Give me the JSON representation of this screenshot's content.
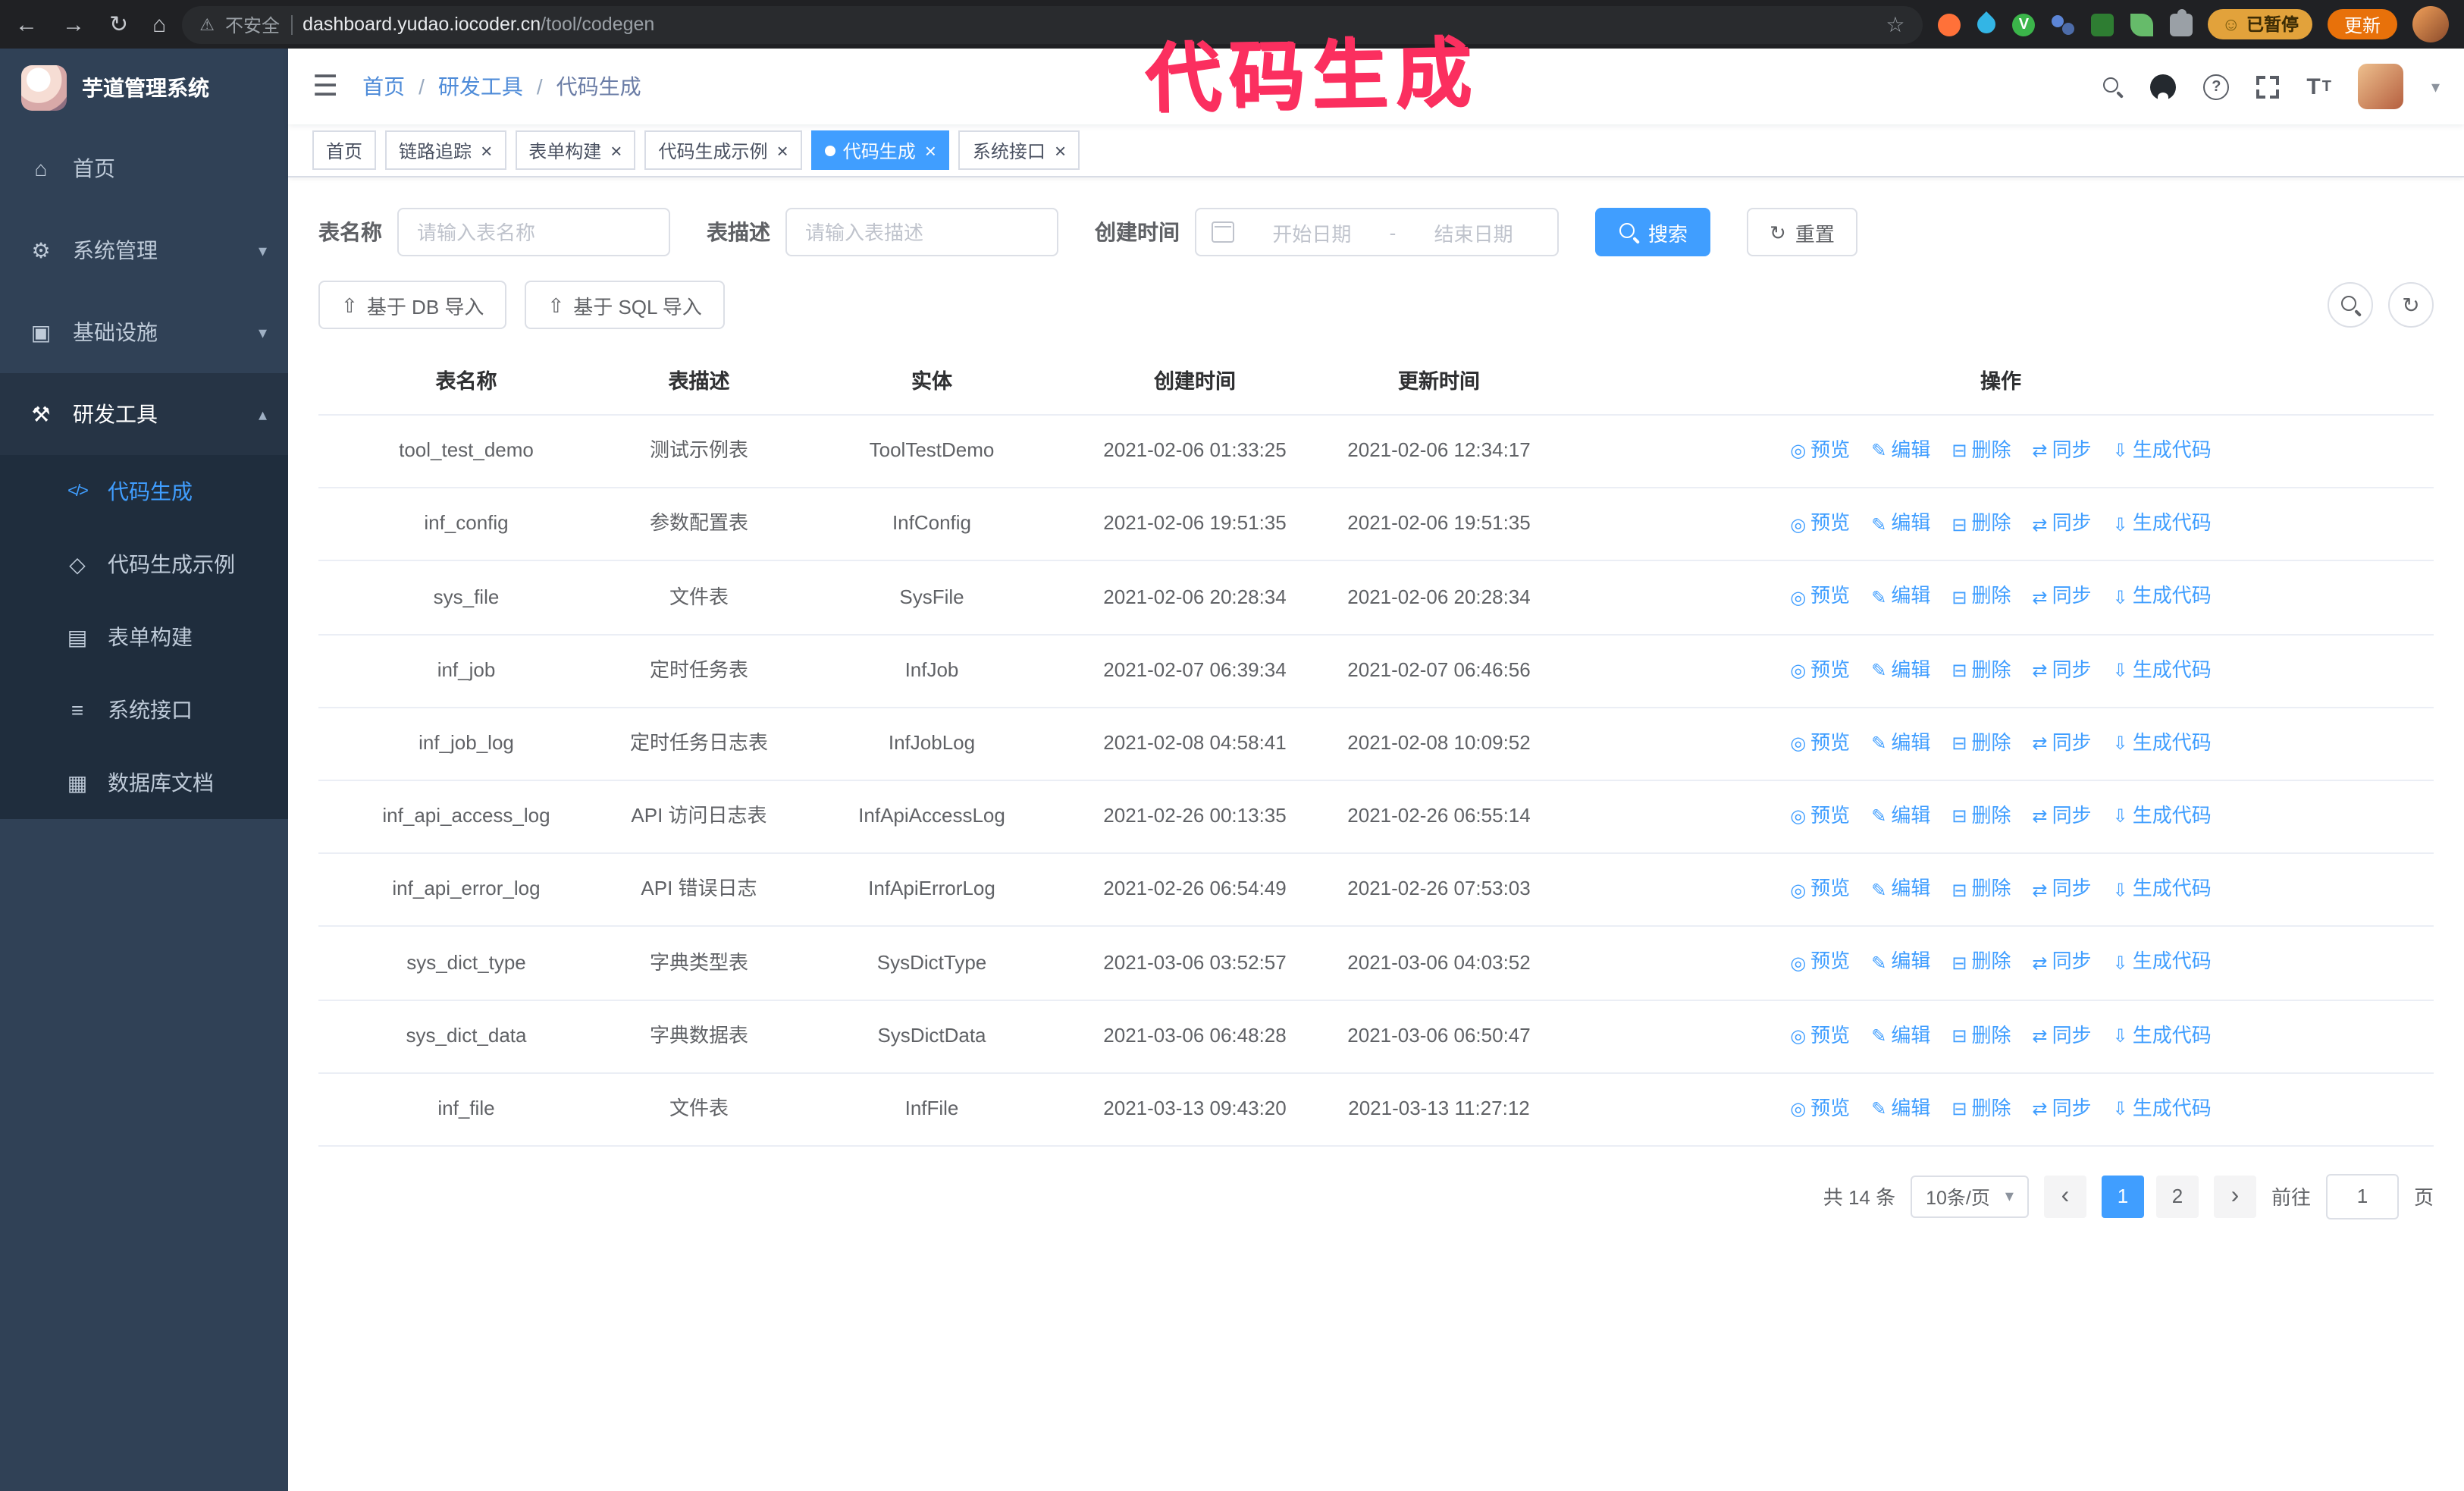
{
  "annotation": {
    "text": "代码生成"
  },
  "colors": {
    "primary": "#409eff",
    "sidebar_bg": "#304156",
    "submenu_bg": "#1f2d3d",
    "annotation": "#fb2f5f",
    "chrome_bg": "#202124",
    "update": "#e8710a",
    "paused": "#e2a23b"
  },
  "browser": {
    "security_warning": "不安全",
    "url_host": "dashboard.yudao.iocoder.cn",
    "url_path": "/tool/codegen",
    "paused_badge": "已暂停",
    "update_button": "更新",
    "extensions": [
      {
        "name": "extension-icon-fox",
        "color": "#ff7139",
        "shape": "circle"
      },
      {
        "name": "extension-icon-drop",
        "color": "#33b5e5",
        "shape": "drop"
      },
      {
        "name": "extension-icon-v",
        "color": "#3bb54a",
        "shape": "circle-letter",
        "letter": "V"
      },
      {
        "name": "extension-icon-people",
        "color": "#5c85d6",
        "shape": "people"
      },
      {
        "name": "extension-icon-green-square",
        "color": "#2e7d32",
        "shape": "square"
      },
      {
        "name": "extension-icon-leaf",
        "color": "#66bb6a",
        "shape": "leaf"
      },
      {
        "name": "extensions-puzzle-icon",
        "color": "#9aa0a6",
        "shape": "puzzle"
      }
    ]
  },
  "sidebar": {
    "logo_title": "芋道管理系统",
    "menu": [
      {
        "id": "home",
        "label": "首页",
        "icon": "home-icon"
      },
      {
        "id": "system-management",
        "label": "系统管理",
        "icon": "gear-icon",
        "chevron": "down"
      },
      {
        "id": "infrastructure",
        "label": "基础设施",
        "icon": "monitor-icon",
        "chevron": "down"
      },
      {
        "id": "dev-tools",
        "label": "研发工具",
        "icon": "tools-icon",
        "chevron": "up",
        "expanded": true,
        "children": [
          {
            "id": "code-generation",
            "label": "代码生成",
            "icon": "code-icon",
            "active": true
          },
          {
            "id": "code-generation-example",
            "label": "代码生成示例",
            "icon": "shield-icon"
          },
          {
            "id": "form-builder",
            "label": "表单构建",
            "icon": "form-icon"
          },
          {
            "id": "system-api",
            "label": "系统接口",
            "icon": "api-icon"
          },
          {
            "id": "database-doc",
            "label": "数据库文档",
            "icon": "database-icon"
          }
        ]
      }
    ]
  },
  "header": {
    "breadcrumb": [
      "首页",
      "研发工具",
      "代码生成"
    ]
  },
  "tabs": [
    {
      "id": "home",
      "label": "首页",
      "closable": false,
      "active": false
    },
    {
      "id": "trace",
      "label": "链路追踪",
      "closable": true,
      "active": false
    },
    {
      "id": "form-builder",
      "label": "表单构建",
      "closable": true,
      "active": false
    },
    {
      "id": "codegen-example",
      "label": "代码生成示例",
      "closable": true,
      "active": false
    },
    {
      "id": "codegen",
      "label": "代码生成",
      "closable": true,
      "active": true
    },
    {
      "id": "system-api",
      "label": "系统接口",
      "closable": true,
      "active": false
    }
  ],
  "filters": {
    "table_name_label": "表名称",
    "table_name_placeholder": "请输入表名称",
    "table_desc_label": "表描述",
    "table_desc_placeholder": "请输入表描述",
    "create_time_label": "创建时间",
    "date_start_placeholder": "开始日期",
    "date_separator": "-",
    "date_end_placeholder": "结束日期",
    "search_button": "搜索",
    "reset_button": "重置"
  },
  "toolbar": {
    "import_db": "基于 DB 导入",
    "import_sql": "基于 SQL 导入"
  },
  "table": {
    "columns": [
      "表名称",
      "表描述",
      "实体",
      "创建时间",
      "更新时间",
      "操作"
    ],
    "actions": [
      {
        "id": "preview",
        "label": "预览"
      },
      {
        "id": "edit",
        "label": "编辑"
      },
      {
        "id": "delete",
        "label": "删除"
      },
      {
        "id": "sync",
        "label": "同步"
      },
      {
        "id": "generate",
        "label": "生成代码"
      }
    ],
    "rows": [
      {
        "name": "tool_test_demo",
        "desc": "测试示例表",
        "entity": "ToolTestDemo",
        "created": "2021-02-06 01:33:25",
        "updated": "2021-02-06 12:34:17"
      },
      {
        "name": "inf_config",
        "desc": "参数配置表",
        "entity": "InfConfig",
        "created": "2021-02-06 19:51:35",
        "updated": "2021-02-06 19:51:35"
      },
      {
        "name": "sys_file",
        "desc": "文件表",
        "entity": "SysFile",
        "created": "2021-02-06 20:28:34",
        "updated": "2021-02-06 20:28:34"
      },
      {
        "name": "inf_job",
        "desc": "定时任务表",
        "entity": "InfJob",
        "created": "2021-02-07 06:39:34",
        "updated": "2021-02-07 06:46:56"
      },
      {
        "name": "inf_job_log",
        "desc": "定时任务日志表",
        "entity": "InfJobLog",
        "created": "2021-02-08 04:58:41",
        "updated": "2021-02-08 10:09:52"
      },
      {
        "name": "inf_api_access_log",
        "desc": "API 访问日志表",
        "entity": "InfApiAccessLog",
        "created": "2021-02-26 00:13:35",
        "updated": "2021-02-26 06:55:14"
      },
      {
        "name": "inf_api_error_log",
        "desc": "API 错误日志",
        "entity": "InfApiErrorLog",
        "created": "2021-02-26 06:54:49",
        "updated": "2021-02-26 07:53:03"
      },
      {
        "name": "sys_dict_type",
        "desc": "字典类型表",
        "entity": "SysDictType",
        "created": "2021-03-06 03:52:57",
        "updated": "2021-03-06 04:03:52"
      },
      {
        "name": "sys_dict_data",
        "desc": "字典数据表",
        "entity": "SysDictData",
        "created": "2021-03-06 06:48:28",
        "updated": "2021-03-06 06:50:47"
      },
      {
        "name": "inf_file",
        "desc": "文件表",
        "entity": "InfFile",
        "created": "2021-03-13 09:43:20",
        "updated": "2021-03-13 11:27:12"
      }
    ]
  },
  "pagination": {
    "total": "共 14 条",
    "page_size": "10条/页",
    "pages": [
      "1",
      "2"
    ],
    "active_page": "1",
    "goto_label": "前往",
    "goto_value": "1",
    "goto_suffix": "页"
  }
}
